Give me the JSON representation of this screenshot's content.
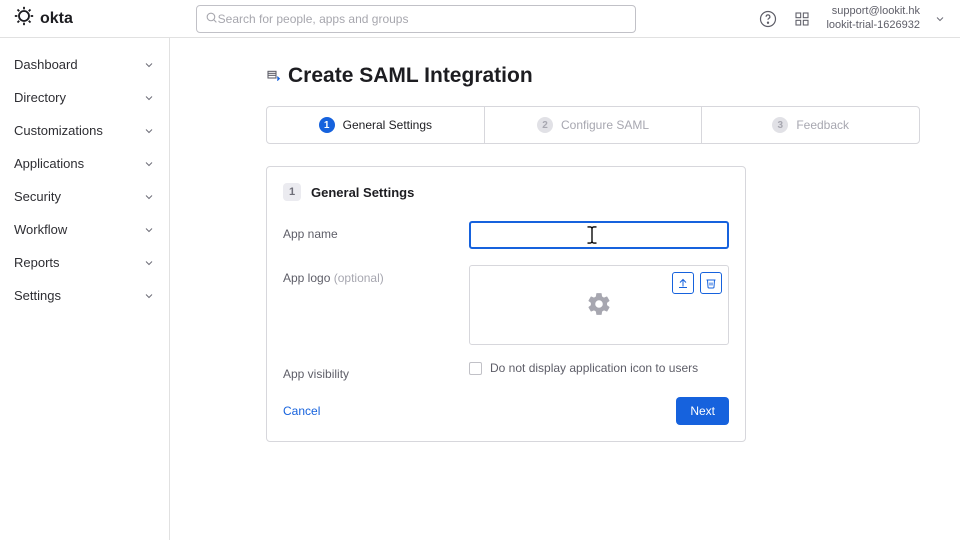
{
  "header": {
    "brand": "okta",
    "search_placeholder": "Search for people, apps and groups",
    "account_email": "support@lookit.hk",
    "account_org": "lookit-trial-1626932"
  },
  "sidebar": {
    "items": [
      {
        "label": "Dashboard"
      },
      {
        "label": "Directory"
      },
      {
        "label": "Customizations"
      },
      {
        "label": "Applications"
      },
      {
        "label": "Security"
      },
      {
        "label": "Workflow"
      },
      {
        "label": "Reports"
      },
      {
        "label": "Settings"
      }
    ]
  },
  "page": {
    "title": "Create SAML Integration"
  },
  "stepper": {
    "steps": [
      {
        "num": "1",
        "label": "General Settings",
        "active": true
      },
      {
        "num": "2",
        "label": "Configure SAML",
        "active": false
      },
      {
        "num": "3",
        "label": "Feedback",
        "active": false
      }
    ]
  },
  "form": {
    "panel_step": "1",
    "panel_title": "General Settings",
    "app_name_label": "App name",
    "app_name_value": "",
    "app_logo_label": "App logo",
    "app_logo_optional": "(optional)",
    "visibility_label": "App visibility",
    "visibility_checkbox_label": "Do not display application icon to users",
    "cancel_label": "Cancel",
    "next_label": "Next"
  }
}
